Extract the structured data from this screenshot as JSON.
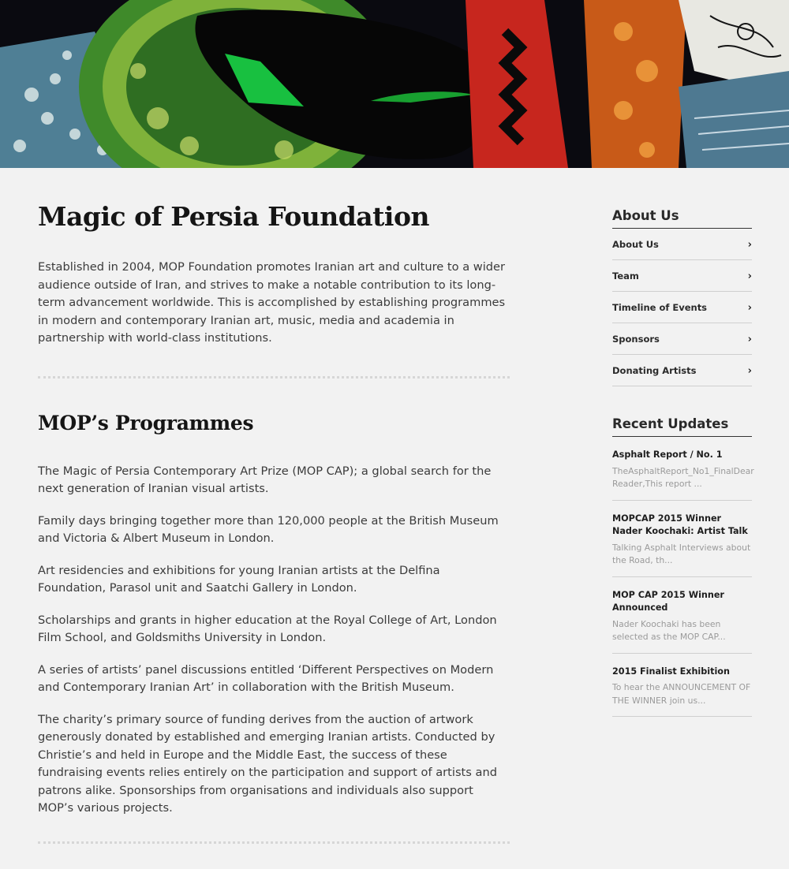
{
  "hero": {
    "alt_icon": "artwork-banner-image"
  },
  "main": {
    "title": "Magic of Persia Foundation",
    "intro": "Established in 2004, MOP Foundation promotes Iranian art and culture to a wider audience outside of Iran, and strives to make a notable contribution to its long-term advancement worldwide. This is accomplished by establishing programmes in modern and contemporary Iranian art, music, media and academia in partnership with world-class institutions.",
    "programmes_title": "MOP’s Programmes",
    "programmes": [
      "The Magic of Persia Contemporary Art Prize (MOP CAP); a global search for the next generation of Iranian visual artists.",
      "Family days bringing together more than 120,000 people at the British Museum and Victoria & Albert Museum in London.",
      "Art residencies and exhibitions for young Iranian artists at the Delfina Foundation, Parasol unit and Saatchi Gallery in London.",
      "Scholarships and grants in higher education at the Royal College of Art, London Film School, and Goldsmiths University in London.",
      "A series of artists’ panel discussions entitled ‘Different Perspectives on Modern and Contemporary Iranian Art’ in collaboration with the British Museum.",
      "The charity’s primary source of funding derives from the auction of artwork generously donated by established and emerging Iranian artists. Conducted by Christie’s and held in Europe and the Middle East, the success of these fundraising events relies entirely on the participation and support of artists and patrons alike. Sponsorships from organisations and individuals also support MOP’s various projects."
    ]
  },
  "sidebar": {
    "about_heading": "About Us",
    "nav": [
      {
        "label": "About Us",
        "chevron": "›"
      },
      {
        "label": "Team",
        "chevron": "›"
      },
      {
        "label": "Timeline of Events",
        "chevron": "›"
      },
      {
        "label": "Sponsors",
        "chevron": "›"
      },
      {
        "label": "Donating Artists",
        "chevron": "›"
      }
    ],
    "recent_heading": "Recent Updates",
    "updates": [
      {
        "title": "Asphalt Report / No. 1",
        "excerpt": "TheAsphaltReport_No1_FinalDear Reader,This report ..."
      },
      {
        "title": "MOPCAP 2015 Winner Nader Koochaki: Artist Talk",
        "excerpt": "Talking Asphalt  Interviews about the Road, th..."
      },
      {
        "title": "MOP CAP 2015 Winner Announced",
        "excerpt": "Nader Koochaki has been selected as the MOP CAP..."
      },
      {
        "title": "2015 Finalist Exhibition",
        "excerpt": "To hear the ANNOUNCEMENT OF THE WINNER join us..."
      }
    ]
  },
  "colors": {
    "background": "#f2f2f2",
    "heading": "#151515",
    "body_text": "#3b3b3b",
    "muted": "#9a9a9a",
    "rule": "#cfcfcf"
  }
}
